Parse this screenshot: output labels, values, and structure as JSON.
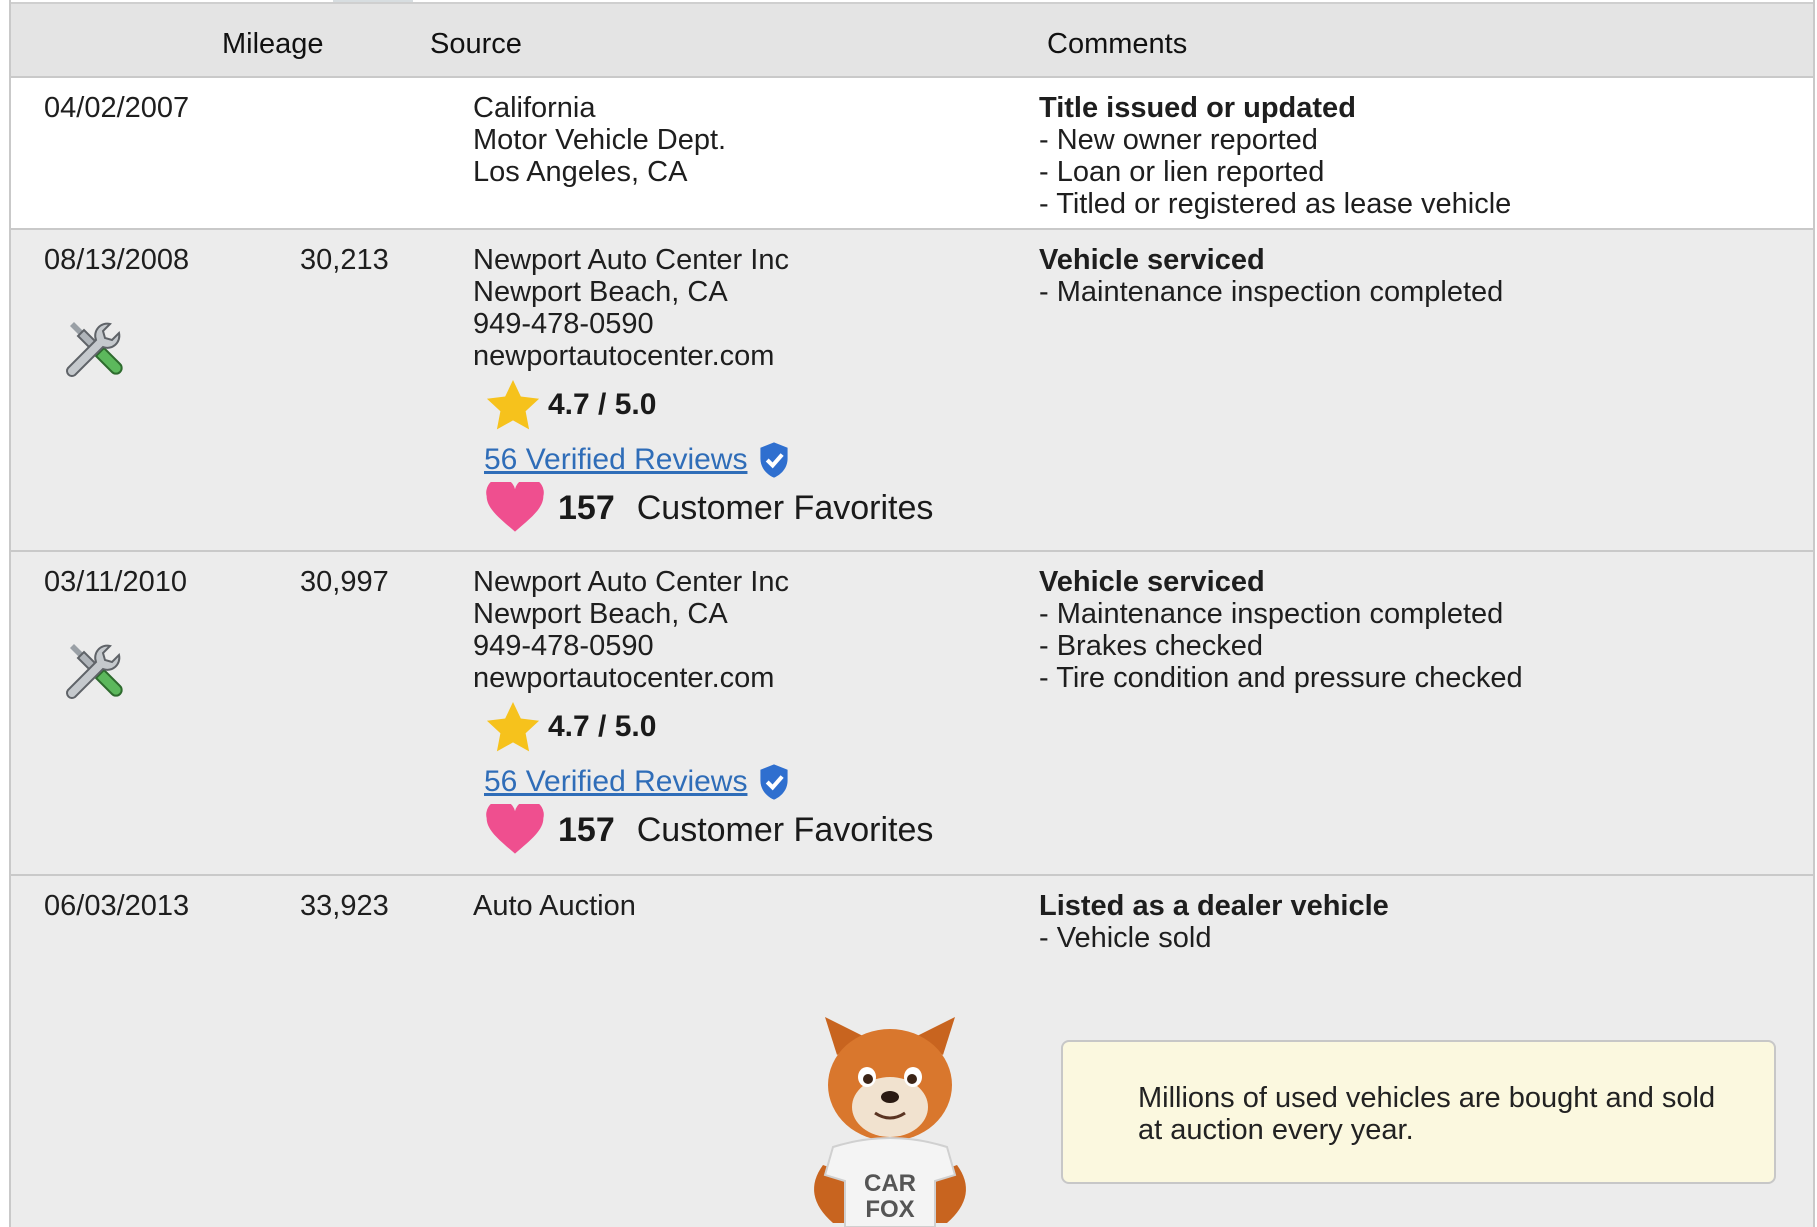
{
  "header": {
    "mileage": "Mileage",
    "source": "Source",
    "comments": "Comments"
  },
  "records": [
    {
      "date": "04/02/2007",
      "mileage": "",
      "source": [
        "California",
        "Motor Vehicle Dept.",
        "Los Angeles, CA"
      ],
      "comment_title": "Title issued or updated",
      "comment_items": [
        "- New owner reported",
        "- Loan or lien reported",
        "- Titled or registered as lease vehicle"
      ]
    },
    {
      "date": "08/13/2008",
      "mileage": "30,213",
      "icon": "service-tools-icon",
      "source": [
        "Newport Auto Center Inc",
        "Newport Beach, CA",
        "949-478-0590",
        "newportautocenter.com"
      ],
      "rating": "4.7 / 5.0",
      "reviews_link": "56 Verified Reviews",
      "favorites_count": "157",
      "favorites_label": "Customer Favorites",
      "comment_title": "Vehicle serviced",
      "comment_items": [
        "- Maintenance inspection completed"
      ]
    },
    {
      "date": "03/11/2010",
      "mileage": "30,997",
      "icon": "service-tools-icon",
      "source": [
        "Newport Auto Center Inc",
        "Newport Beach, CA",
        "949-478-0590",
        "newportautocenter.com"
      ],
      "rating": "4.7 / 5.0",
      "reviews_link": "56 Verified Reviews",
      "favorites_count": "157",
      "favorites_label": "Customer Favorites",
      "comment_title": "Vehicle serviced",
      "comment_items": [
        "- Maintenance inspection completed",
        "- Brakes checked",
        "- Tire condition and pressure checked"
      ]
    },
    {
      "date": "06/03/2013",
      "mileage": "33,923",
      "source": [
        "Auto Auction"
      ],
      "comment_title": "Listed as a dealer vehicle",
      "comment_items": [
        "- Vehicle sold"
      ]
    }
  ],
  "mascot": {
    "shirt_line1": "CAR",
    "shirt_line2": "FOX"
  },
  "tip": {
    "text": "Millions of used vehicles are bought and sold at auction every year."
  },
  "colors": {
    "link": "#2f6db8",
    "star": "#f6c21c",
    "heart": "#ef4f8f",
    "verified_shield": "#2f6fcf",
    "tip_bg": "#fbf8df"
  }
}
